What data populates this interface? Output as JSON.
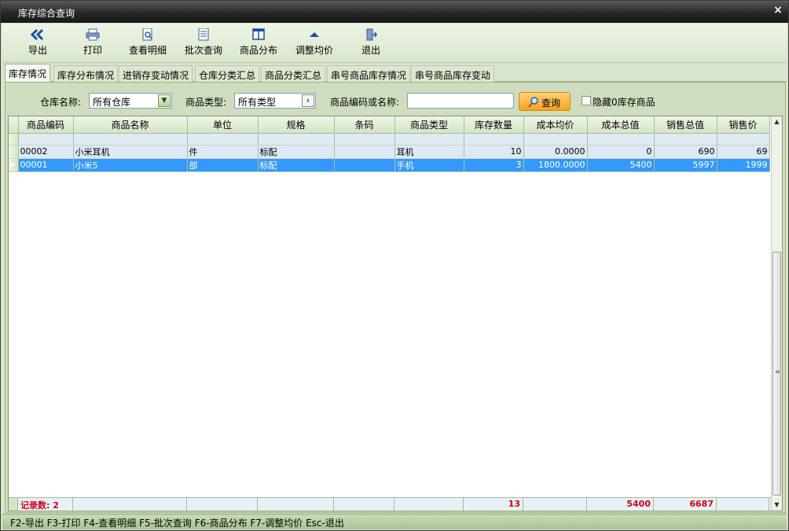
{
  "window": {
    "title": "库存综合查询",
    "close_symbol": "×"
  },
  "toolbar": {
    "buttons": [
      {
        "label": "导出",
        "icon": "double-chevron-left-icon"
      },
      {
        "label": "打印",
        "icon": "printer-icon"
      },
      {
        "label": "查看明细",
        "icon": "document-search-icon"
      },
      {
        "label": "批次查询",
        "icon": "list-document-icon"
      },
      {
        "label": "商品分布",
        "icon": "columns-icon"
      },
      {
        "label": "调整均价",
        "icon": "triangle-up-icon"
      },
      {
        "label": "退出",
        "icon": "exit-door-icon"
      }
    ]
  },
  "tabs": [
    {
      "label": "库存情况",
      "active": true
    },
    {
      "label": "库存分布情况"
    },
    {
      "label": "进销存变动情况"
    },
    {
      "label": "仓库分类汇总"
    },
    {
      "label": "商品分类汇总"
    },
    {
      "label": "串号商品库存情况"
    },
    {
      "label": "串号商品库存变动"
    }
  ],
  "filters": {
    "warehouse_label": "仓库名称:",
    "warehouse_value": "所有仓库",
    "category_label": "商品类型:",
    "category_value": "所有类型",
    "code_label": "商品编码或名称:",
    "code_value": "",
    "search_label": "查询",
    "hide_zero_label": "隐藏0库存商品",
    "hide_zero_checked": false
  },
  "grid": {
    "columns": [
      "商品编码",
      "商品名称",
      "单位",
      "规格",
      "条码",
      "商品类型",
      "库存数量",
      "成本均价",
      "成本总值",
      "销售总值",
      "销售价"
    ],
    "rows": [
      [
        "00002",
        "小米耳机",
        "件",
        "标配",
        "",
        "耳机",
        "10",
        "0.0000",
        "0",
        "690",
        "69"
      ],
      [
        "00001",
        "小米5",
        "部",
        "标配",
        "",
        "手机",
        "3",
        "1800.0000",
        "5400",
        "5997",
        "1999"
      ]
    ],
    "selected_row": 1,
    "footer": {
      "record_count": "记录数: 2",
      "qty_total": "13",
      "cost_total": "5400",
      "sales_total": "6687"
    }
  },
  "statusbar": {
    "text": "F2-导出 F3-打印 F4-查看明细 F5-批次查询 F6-商品分布 F7-调整均价 Esc-退出"
  },
  "colors": {
    "accent_red": "#d0021b",
    "selected_row": "#3399ff",
    "search_button": "#f7a21c"
  }
}
